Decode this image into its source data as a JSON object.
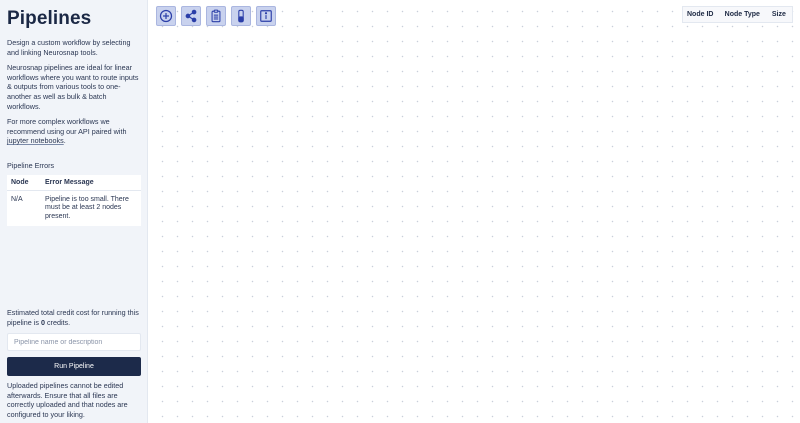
{
  "sidebar": {
    "title": "Pipelines",
    "para1": "Design a custom workflow by selecting and linking Neurosnap tools.",
    "para2": "Neurosnap pipelines are ideal for linear workflows where you want to route inputs & outputs from various tools to one-another as well as bulk & batch workflows.",
    "para3_prefix": "For more complex workflows we recommend using our API paired with ",
    "para3_link": "jupyter notebooks",
    "para3_suffix": ".",
    "errors_label": "Pipeline Errors",
    "errors_table": {
      "headers": [
        "Node",
        "Error Message"
      ],
      "rows": [
        {
          "node": "N/A",
          "message": "Pipeline is too small. There must be at least 2 nodes present."
        }
      ]
    },
    "cost_prefix": "Estimated total credit cost for running this pipeline is ",
    "cost_value": "0",
    "cost_suffix": " credits.",
    "name_placeholder": "Pipeline name or description",
    "run_label": "Run Pipeline",
    "note": "Uploaded pipelines cannot be edited afterwards. Ensure that all files are correctly uploaded and that nodes are configured to your liking."
  },
  "toolbar": {
    "icons": [
      "add-circle-icon",
      "share-icon",
      "clipboard-icon",
      "test-tube-icon",
      "info-icon"
    ]
  },
  "node_table": {
    "headers": [
      "Node ID",
      "Node Type",
      "Size"
    ]
  },
  "colors": {
    "sidebar_bg": "#f1f4f9",
    "primary": "#1c2a4a",
    "tool_bg": "#c9d2ee",
    "icon": "#2b3ea8"
  }
}
